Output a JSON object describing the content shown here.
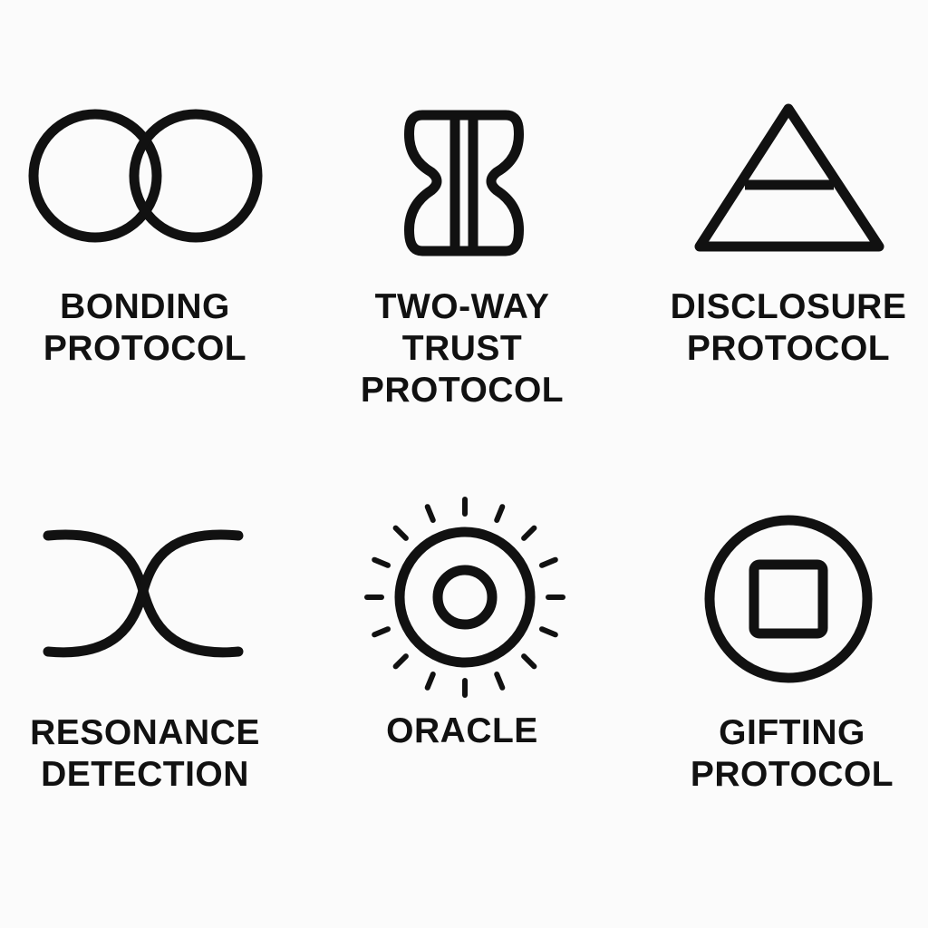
{
  "colors": {
    "ink": "#111111",
    "background": "#fbfbfb"
  },
  "symbols": [
    {
      "icon": "interlocking-rings-icon",
      "label_lines": [
        "BONDING",
        "PROTOCOL"
      ]
    },
    {
      "icon": "split-pillar-icon",
      "label_lines": [
        "TWO-WAY",
        "TRUST",
        "PROTOCOL"
      ]
    },
    {
      "icon": "bisected-triangle-icon",
      "label_lines": [
        "DISCLOSURE",
        "PROTOCOL"
      ]
    },
    {
      "icon": "crossing-curves-icon",
      "label_lines": [
        "RESONANCE",
        "DETECTION"
      ]
    },
    {
      "icon": "radiant-sun-icon",
      "label_lines": [
        "ORACLE"
      ]
    },
    {
      "icon": "square-in-circle-icon",
      "label_lines": [
        "GIFTING",
        "PROTOCOL"
      ]
    }
  ]
}
